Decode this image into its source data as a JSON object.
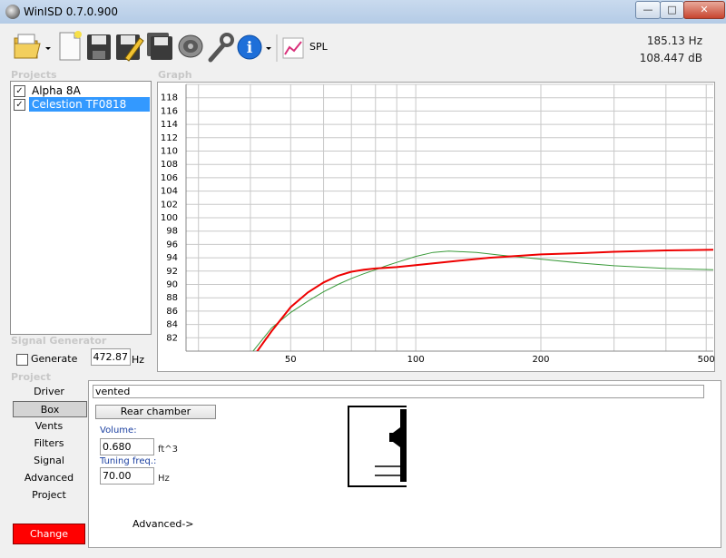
{
  "window": {
    "title": "WinISD 0.7.0.900",
    "minimize": "—",
    "maximize": "□",
    "close": "✕"
  },
  "toolbar": {
    "buttons": [
      {
        "name": "open",
        "icon": "folder-icon"
      },
      {
        "name": "new",
        "icon": "new-file-icon"
      },
      {
        "name": "save",
        "icon": "save-icon"
      },
      {
        "name": "edit",
        "icon": "edit-icon"
      },
      {
        "name": "save-all",
        "icon": "save-all-icon"
      },
      {
        "name": "driver",
        "icon": "speaker-icon"
      },
      {
        "name": "settings",
        "icon": "wrench-icon"
      },
      {
        "name": "info",
        "icon": "info-icon"
      }
    ],
    "spl_label": "SPL",
    "freq_readout": "185.13 Hz",
    "db_readout": "108.447 dB"
  },
  "projects": {
    "label": "Projects",
    "items": [
      {
        "label": "Alpha 8A",
        "checked": "✓",
        "selected": false
      },
      {
        "label": "Celestion TF0818",
        "checked": "✓",
        "selected": true
      }
    ]
  },
  "graph": {
    "label": "Graph",
    "colors": {
      "grid": "#c8c8c8",
      "red": "#ee0000",
      "green": "#3a9a3a"
    }
  },
  "signal_generator": {
    "label": "Signal Generator",
    "generate_label": "Generate",
    "frequency": "472.87",
    "unit": "Hz"
  },
  "project": {
    "label": "Project",
    "nav": [
      "Driver",
      "Box",
      "Vents",
      "Filters",
      "Signal",
      "Advanced",
      "Project"
    ],
    "active": "Box",
    "change_label": "Change"
  },
  "box": {
    "type": "vented",
    "rear_chamber_label": "Rear chamber",
    "volume_label": "Volume:",
    "volume_value": "0.680",
    "volume_unit": "ft^3",
    "tuning_label": "Tuning freq.:",
    "tuning_value": "70.00",
    "tuning_unit": "Hz",
    "advanced_label": "Advanced->"
  },
  "chart_data": {
    "type": "line",
    "title": "",
    "xlabel": "",
    "ylabel": "",
    "x_scale": "log",
    "xlim": [
      28,
      520
    ],
    "ylim": [
      80,
      120
    ],
    "x_ticks": [
      50,
      100,
      200,
      500
    ],
    "y_ticks": [
      82,
      84,
      86,
      88,
      90,
      92,
      94,
      96,
      98,
      100,
      102,
      104,
      106,
      108,
      110,
      112,
      114,
      116,
      118
    ],
    "grid": true,
    "series": [
      {
        "color": "#ee0000",
        "x": [
          41,
          45,
          50,
          55,
          60,
          65,
          70,
          75,
          80,
          85,
          90,
          100,
          120,
          150,
          200,
          250,
          300,
          400,
          520
        ],
        "y": [
          79.5,
          83,
          86.6,
          88.8,
          90.3,
          91.3,
          91.9,
          92.2,
          92.4,
          92.5,
          92.6,
          92.9,
          93.4,
          94.0,
          94.5,
          94.7,
          94.9,
          95.1,
          95.2
        ]
      },
      {
        "color": "#3a9a3a",
        "x": [
          40,
          45,
          50,
          55,
          60,
          65,
          70,
          75,
          80,
          85,
          90,
          100,
          110,
          120,
          140,
          160,
          200,
          250,
          300,
          400,
          520
        ],
        "y": [
          79.5,
          83.5,
          85.8,
          87.5,
          88.9,
          90.0,
          90.9,
          91.6,
          92.2,
          92.8,
          93.3,
          94.2,
          94.8,
          95.0,
          94.8,
          94.4,
          93.8,
          93.2,
          92.8,
          92.4,
          92.2
        ]
      }
    ]
  }
}
